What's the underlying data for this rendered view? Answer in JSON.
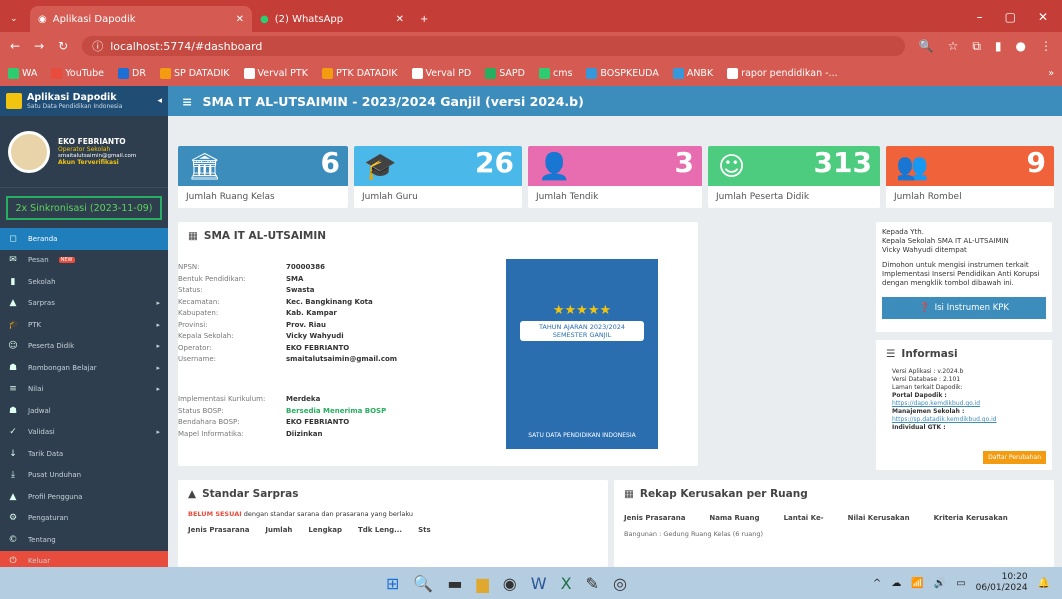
{
  "browser": {
    "tabs": [
      {
        "label": "Aplikasi Dapodik"
      },
      {
        "label": "(2) WhatsApp"
      }
    ],
    "url": "localhost:5774/#dashboard"
  },
  "bookmarks": [
    "WA",
    "YouTube",
    "DR",
    "SP DATADIK",
    "Verval PTK",
    "PTK DATADIK",
    "Verval PD",
    "SAPD",
    "cms",
    "BOSPKEUDA",
    "ANBK",
    "rapor pendidikan -..."
  ],
  "sidebar": {
    "app_title": "Aplikasi Dapodik",
    "app_subtitle": "Satu Data Pendidikan Indonesia",
    "user_name": "EKO FEBRIANTO",
    "user_role": "Operator Sekolah",
    "user_email": "smaitalutsaimin@gmail.com",
    "user_status": "Akun Terverifikasi",
    "sync": "2x Sinkronisasi (2023-11-09)",
    "new_badge": "NEW",
    "items": [
      {
        "label": "Beranda",
        "icon": "◻",
        "car": ""
      },
      {
        "label": "Pesan",
        "icon": "✉",
        "car": ""
      },
      {
        "label": "Sekolah",
        "icon": "▮",
        "car": ""
      },
      {
        "label": "Sarpras",
        "icon": "▲",
        "car": "▸"
      },
      {
        "label": "PTK",
        "icon": "🎓",
        "car": "▸"
      },
      {
        "label": "Peserta Didik",
        "icon": "☺",
        "car": "▸"
      },
      {
        "label": "Rombongan Belajar",
        "icon": "☗",
        "car": "▸"
      },
      {
        "label": "Nilai",
        "icon": "≡",
        "car": "▸"
      },
      {
        "label": "Jadwal",
        "icon": "☗",
        "car": ""
      },
      {
        "label": "Validasi",
        "icon": "✓",
        "car": "▸"
      },
      {
        "label": "Tarik Data",
        "icon": "↓",
        "car": ""
      },
      {
        "label": "Pusat Unduhan",
        "icon": "⤓",
        "car": ""
      },
      {
        "label": "Profil Pengguna",
        "icon": "▲",
        "car": ""
      },
      {
        "label": "Pengaturan",
        "icon": "⚙",
        "car": ""
      },
      {
        "label": "Tentang",
        "icon": "©",
        "car": ""
      },
      {
        "label": "Keluar",
        "icon": "⏻",
        "car": ""
      }
    ]
  },
  "header": {
    "title": "SMA IT AL-UTSAIMIN - 2023/2024 Ganjil (versi 2024.b)"
  },
  "stats": [
    {
      "value": "6",
      "label": "Jumlah Ruang Kelas",
      "color": "#3c8dbc",
      "icon": "🏛"
    },
    {
      "value": "26",
      "label": "Jumlah Guru",
      "color": "#4ab8e8",
      "icon": "🎓"
    },
    {
      "value": "3",
      "label": "Jumlah Tendik",
      "color": "#e86cb0",
      "icon": "👤"
    },
    {
      "value": "313",
      "label": "Jumlah Peserta Didik",
      "color": "#4dcc7f",
      "icon": "☺"
    },
    {
      "value": "9",
      "label": "Jumlah Rombel",
      "color": "#f0623a",
      "icon": "👥"
    }
  ],
  "school": {
    "title": "SMA IT AL-UTSAIMIN",
    "rows": [
      [
        "NPSN:",
        "70000386"
      ],
      [
        "Bentuk Pendidikan:",
        "SMA"
      ],
      [
        "Status:",
        "Swasta"
      ],
      [
        "Kecamatan:",
        "Kec. Bangkinang Kota"
      ],
      [
        "Kabupaten:",
        "Kab. Kampar"
      ],
      [
        "Provinsi:",
        "Prov. Riau"
      ],
      [
        "Kepala Sekolah:",
        "Vicky Wahyudi"
      ],
      [
        "Operator:",
        "EKO FEBRIANTO"
      ],
      [
        "Username:",
        "smaitalutsaimin@gmail.com"
      ]
    ],
    "rows2": [
      [
        "Implementasi Kurikulum:",
        "Merdeka"
      ],
      [
        "Status BOSP:",
        "Bersedia Menerima BOSP"
      ],
      [
        "Bendahara BOSP:",
        "EKO FEBRIANTO"
      ],
      [
        "Mapel Informatika:",
        "Diizinkan"
      ]
    ]
  },
  "poster": {
    "line1": "TAHUN AJARAN 2023/2024",
    "line2": "SEMESTER GANJIL",
    "footer": "SATU DATA PENDIDIKAN INDONESIA"
  },
  "kpk": {
    "to": "Kepada Yth.",
    "to2": "Kepala Sekolah SMA IT AL-UTSAIMIN",
    "to3": "Vicky Wahyudi ditempat",
    "msg": "Dimohon untuk mengisi instrumen terkait Implementasi Insersi Pendidikan Anti Korupsi dengan mengklik tombol dibawah ini.",
    "button": "Isi Instrumen KPK"
  },
  "informasi": {
    "title": "Informasi",
    "app": "Versi Aplikasi : v.2024.b",
    "db": "Versi Database : 2.101",
    "laman": "Laman terkait Dapodik:",
    "portal": "Portal Dapodik :",
    "portal_url": "https://dapo.kemdikbud.go.id",
    "mgr": "Manajemen Sekolah :",
    "mgr_url": "https://sp.datadik.kemdikbud.go.id",
    "gtk": "Individual GTK :",
    "daftar": "Daftar Perubahan"
  },
  "sarpras": {
    "title": "Standar Sarpras",
    "warn": "BELUM SESUAI",
    "warn_rest": "dengan standar sarana dan prasarana yang berlaku",
    "cols": [
      "Jenis Prasarana",
      "Jumlah",
      "Lengkap",
      "Tdk Leng...",
      "Sts"
    ]
  },
  "rekap": {
    "title": "Rekap Kerusakan per Ruang",
    "cols": [
      "Jenis Prasarana",
      "Nama Ruang",
      "Lantai Ke-",
      "Nilai Kerusakan",
      "Kriteria Kerusakan"
    ],
    "row": "Bangunan : Gedung Ruang Kelas (6 ruang)"
  },
  "taskbar": {
    "time": "10:20",
    "date": "06/01/2024"
  }
}
